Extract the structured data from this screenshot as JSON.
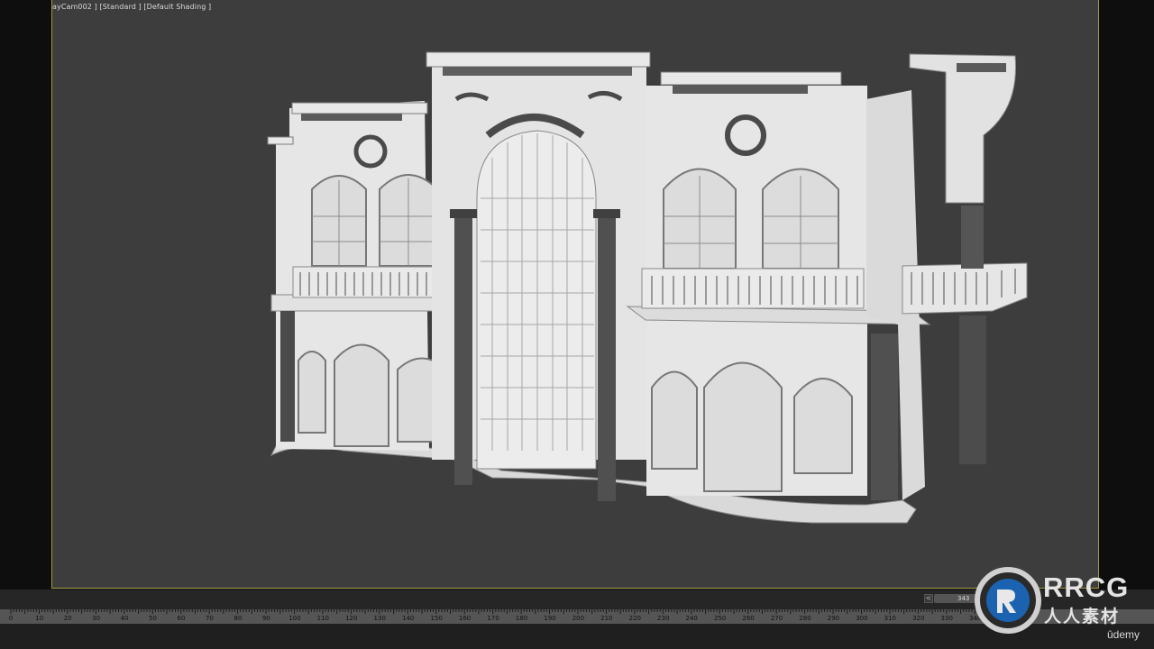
{
  "viewport": {
    "label": "ayCam002 ] [Standard ] [Default Shading ]"
  },
  "timeline": {
    "arrow": "<",
    "frame": "343",
    "ticks": [
      "0",
      "10",
      "20",
      "30",
      "40",
      "50",
      "60",
      "70",
      "80",
      "90",
      "100",
      "110",
      "120",
      "130",
      "140",
      "150",
      "160",
      "170",
      "180",
      "190",
      "200",
      "210",
      "220",
      "230",
      "240",
      "250",
      "260",
      "270",
      "280",
      "290",
      "300",
      "310",
      "320",
      "330",
      "340"
    ]
  },
  "watermark": {
    "brand": "RRCG",
    "subtitle": "人人素材"
  },
  "footer": {
    "udemy": "ûdemy"
  },
  "colors": {
    "viewport_bg": "#3d3d3d",
    "viewport_border": "#a39a3c",
    "model_face": "#e3e3e3",
    "model_ornament": "#4a4a4a"
  }
}
